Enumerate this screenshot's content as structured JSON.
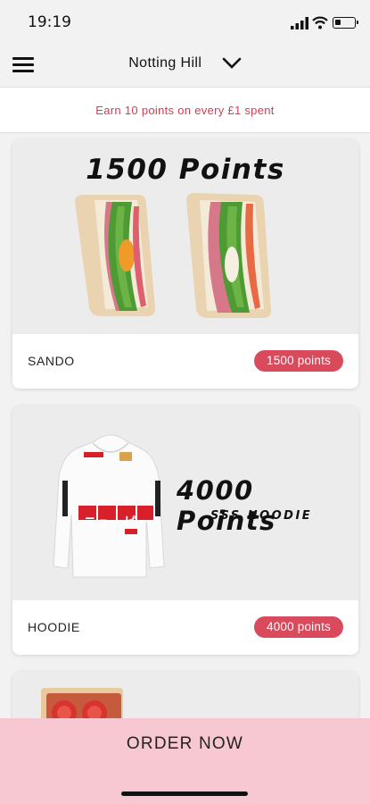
{
  "status_bar": {
    "time": "19:19"
  },
  "header": {
    "location": "Notting Hill"
  },
  "banner": {
    "text": "Earn 10 points on every £1 spent"
  },
  "rewards": [
    {
      "name": "SANDO",
      "points_label": "1500 points",
      "headline": "1500 Points",
      "subline": ""
    },
    {
      "name": "HOODIE",
      "points_label": "4000 points",
      "headline": "4000 Points",
      "subline": "SSS HOODIE"
    }
  ],
  "hoodie_print": {
    "katakana": "ニューピー",
    "vertical_text": "大阪サン"
  },
  "order_bar": {
    "label": "ORDER NOW"
  },
  "colors": {
    "accent": "#d94a5c",
    "banner_text": "#d63c50",
    "order_bar": "#f7c8d1"
  },
  "icons": [
    "menu-icon",
    "chevron-down-icon",
    "signal-icon",
    "wifi-icon",
    "battery-icon"
  ]
}
